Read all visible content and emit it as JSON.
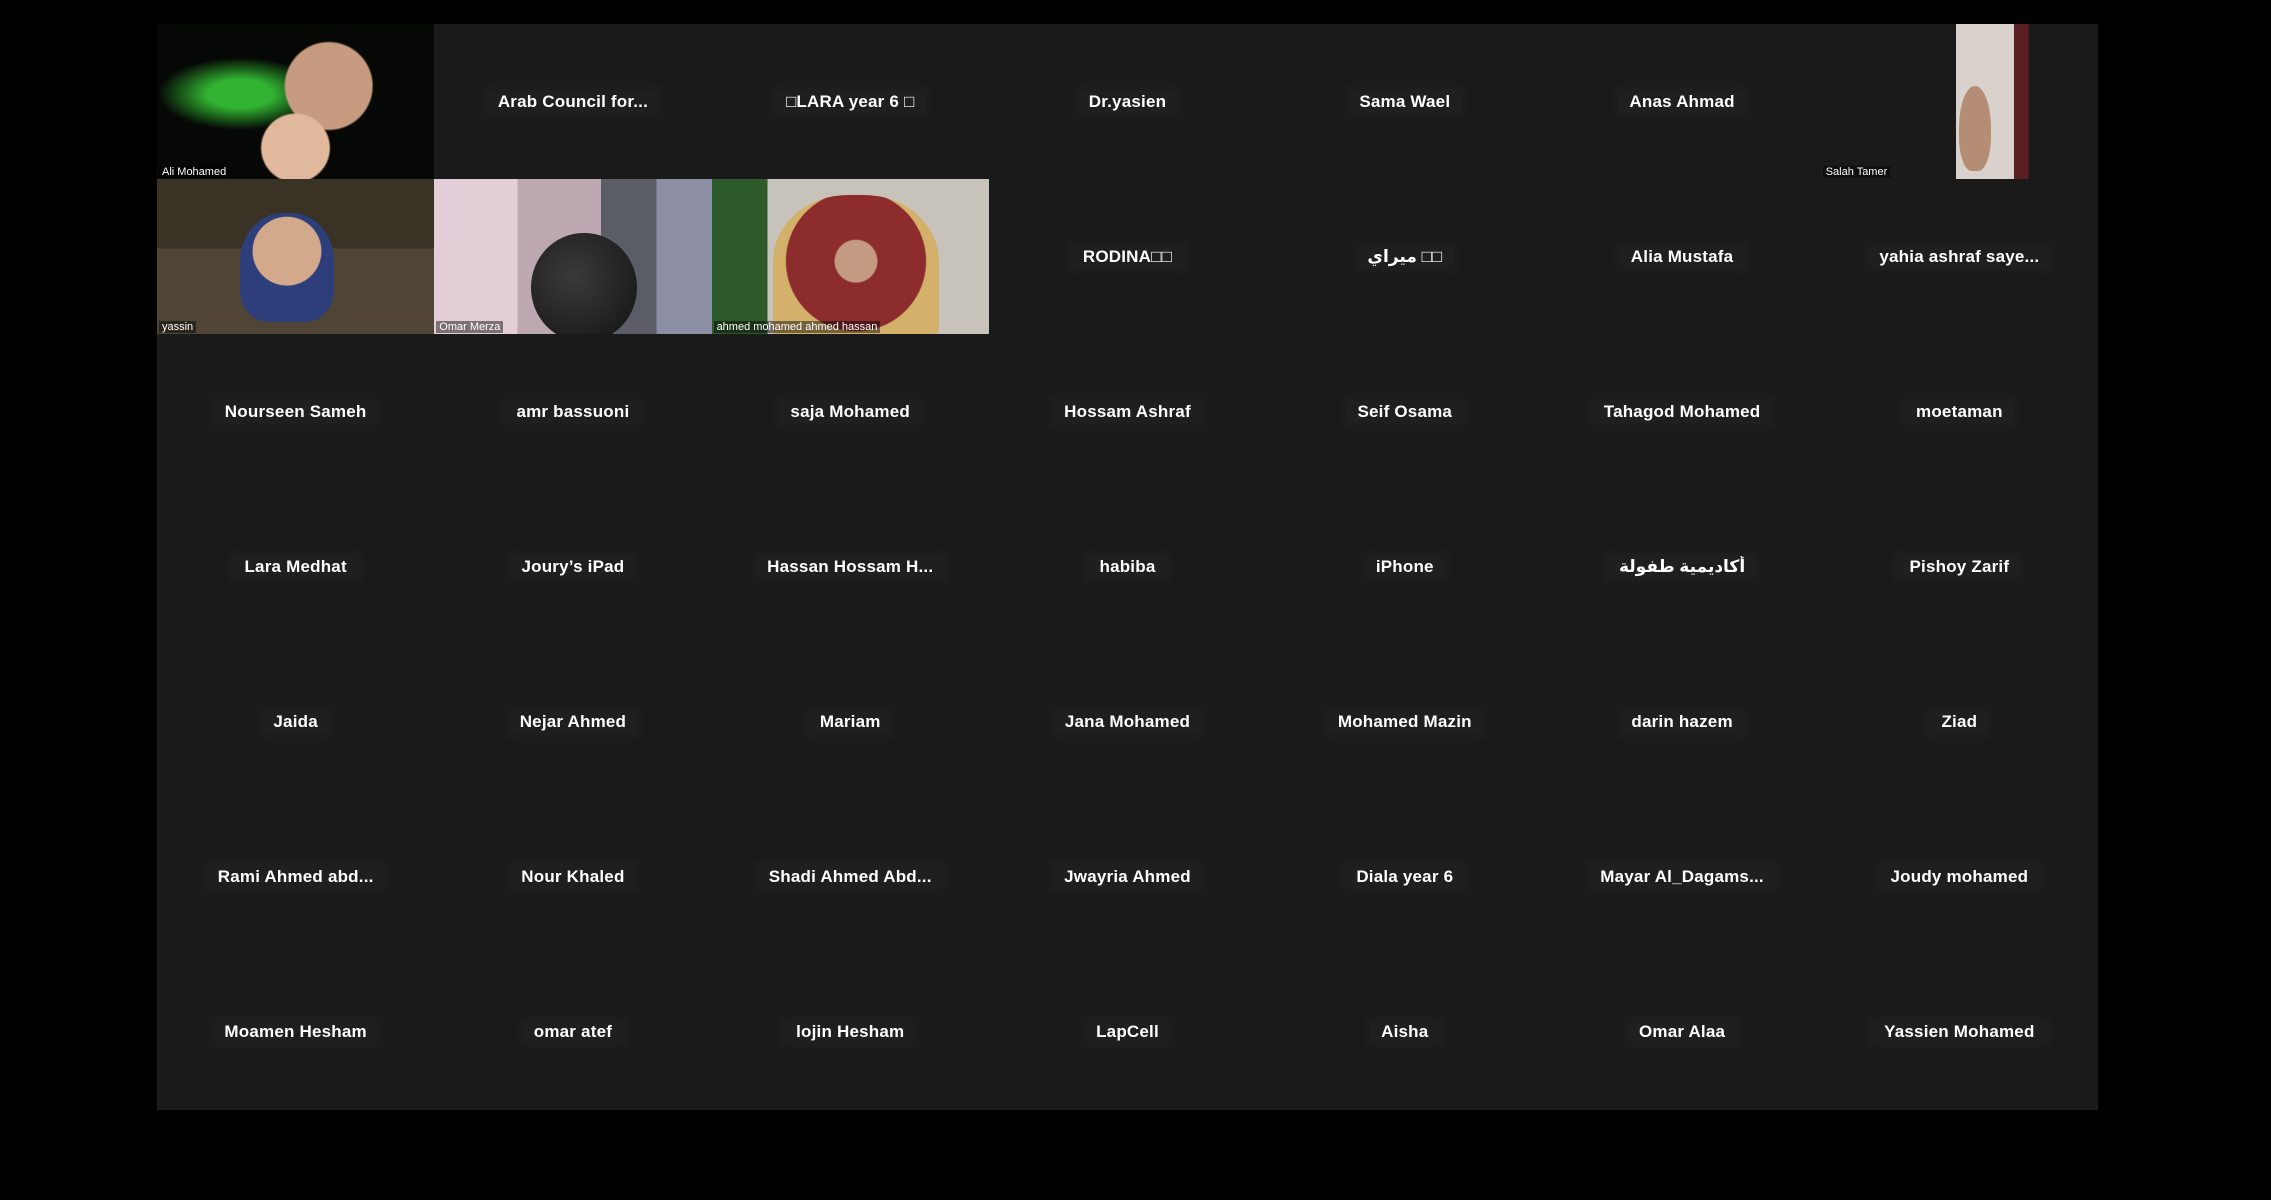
{
  "participants": [
    {
      "name": "Ali Mohamed",
      "video": true
    },
    {
      "name": "Arab Council for..."
    },
    {
      "name": "□LARA year 6 □"
    },
    {
      "name": "Dr.yasien"
    },
    {
      "name": "Sama Wael"
    },
    {
      "name": "Anas Ahmad"
    },
    {
      "name": "Salah Tamer",
      "video": true
    },
    {
      "name": "yassin",
      "video": true
    },
    {
      "name": "Omar Merza",
      "video": true
    },
    {
      "name": "ahmed mohamed ahmed hassan",
      "video": true
    },
    {
      "name": "RODINA□□"
    },
    {
      "name": "ميراي □□"
    },
    {
      "name": "Alia Mustafa"
    },
    {
      "name": "yahia ashraf saye..."
    },
    {
      "name": "Nourseen  Sameh"
    },
    {
      "name": "amr bassuoni"
    },
    {
      "name": "saja Mohamed"
    },
    {
      "name": "Hossam Ashraf"
    },
    {
      "name": "Seif Osama"
    },
    {
      "name": "Tahagod Mohamed"
    },
    {
      "name": "moetaman"
    },
    {
      "name": "Lara Medhat"
    },
    {
      "name": "Joury’s iPad"
    },
    {
      "name": "Hassan  Hossam  H..."
    },
    {
      "name": "habiba"
    },
    {
      "name": "iPhone"
    },
    {
      "name": "أكاديمية طفولة"
    },
    {
      "name": "Pishoy Zarif"
    },
    {
      "name": "Jaida"
    },
    {
      "name": "Nejar Ahmed"
    },
    {
      "name": "Mariam"
    },
    {
      "name": "Jana Mohamed"
    },
    {
      "name": "Mohamed Mazin"
    },
    {
      "name": "darin hazem"
    },
    {
      "name": "Ziad"
    },
    {
      "name": "Rami  Ahmed  abd..."
    },
    {
      "name": "Nour Khaled"
    },
    {
      "name": "Shadi  Ahmed  Abd..."
    },
    {
      "name": "Jwayria Ahmed"
    },
    {
      "name": "Diala year 6"
    },
    {
      "name": "Mayar  Al_Dagams..."
    },
    {
      "name": "Joudy mohamed"
    },
    {
      "name": "Moamen Hesham"
    },
    {
      "name": "omar atef"
    },
    {
      "name": "lojin  Hesham"
    },
    {
      "name": "LapCell"
    },
    {
      "name": "Aisha"
    },
    {
      "name": "Omar Alaa"
    },
    {
      "name": "Yassien Mohamed"
    }
  ],
  "colors": {
    "background": "#000000",
    "gallery": "#1a1a1a",
    "name_text": "#ffffff"
  }
}
